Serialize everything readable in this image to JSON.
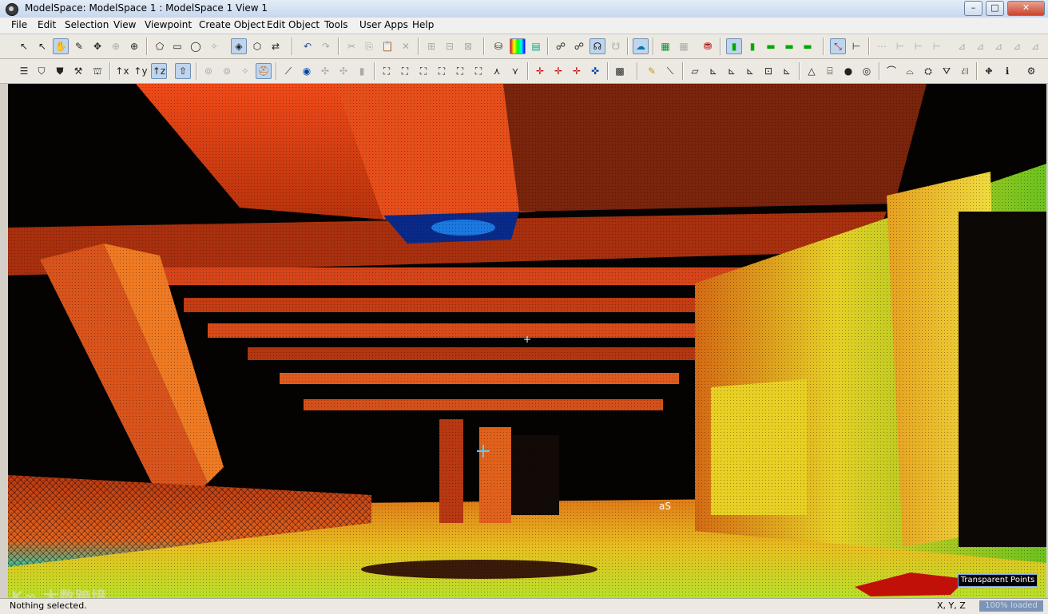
{
  "window": {
    "title": "ModelSpace: ModelSpace 1 : ModelSpace 1 View 1",
    "controls": {
      "minimize": "–",
      "maximize": "□",
      "close": "✕"
    }
  },
  "menu": [
    "File",
    "Edit",
    "Selection",
    "View",
    "Viewpoint",
    "Create Object",
    "Edit Object",
    "Tools",
    "User Apps",
    "Help"
  ],
  "toolbar1": {
    "icons": [
      "select-arrow-icon",
      "select-plus-icon",
      "pan-hand-icon",
      "pencil-icon",
      "move-icon",
      "rotate-icon",
      "target-icon",
      "fence-icon",
      "rectangle-icon",
      "circle-icon",
      "select-off-icon",
      "shaded-view-icon",
      "box-view-icon",
      "swap-icon",
      "undo-icon",
      "redo-icon",
      "cut-icon",
      "copy-icon",
      "paste-icon",
      "delete-icon",
      "group-icon",
      "ungroup-icon",
      "merge-icon",
      "layer-color-icon",
      "color-map-icon",
      "color-scale-icon",
      "view-a-icon",
      "view-b-icon",
      "view-c-icon",
      "view-d-icon",
      "render-icon",
      "grid-icon",
      "grid-off-icon",
      "clip-icon",
      "green-1-icon",
      "green-2-icon",
      "green-3-icon",
      "green-4-icon",
      "green-5-icon",
      "axis-icon",
      "axis-b-icon",
      "disabled-icons"
    ],
    "labels": {
      "undo": "↶",
      "redo": "↷"
    }
  },
  "toolbar2": {
    "axes": [
      "↑x",
      "↑y",
      "↑z"
    ]
  },
  "status": {
    "left_text": "Nothing selected.",
    "coords_label": "X, Y, Z",
    "loaded_text": "100% loaded"
  },
  "viewport": {
    "transparent_points_label": "Transparent Points",
    "watermark": "K∞ 大数跨境"
  },
  "colors": {
    "accent": "#7ca4e6",
    "point_red": "#e8401a",
    "point_yellow": "#e8e020",
    "point_green": "#3fd34a"
  }
}
